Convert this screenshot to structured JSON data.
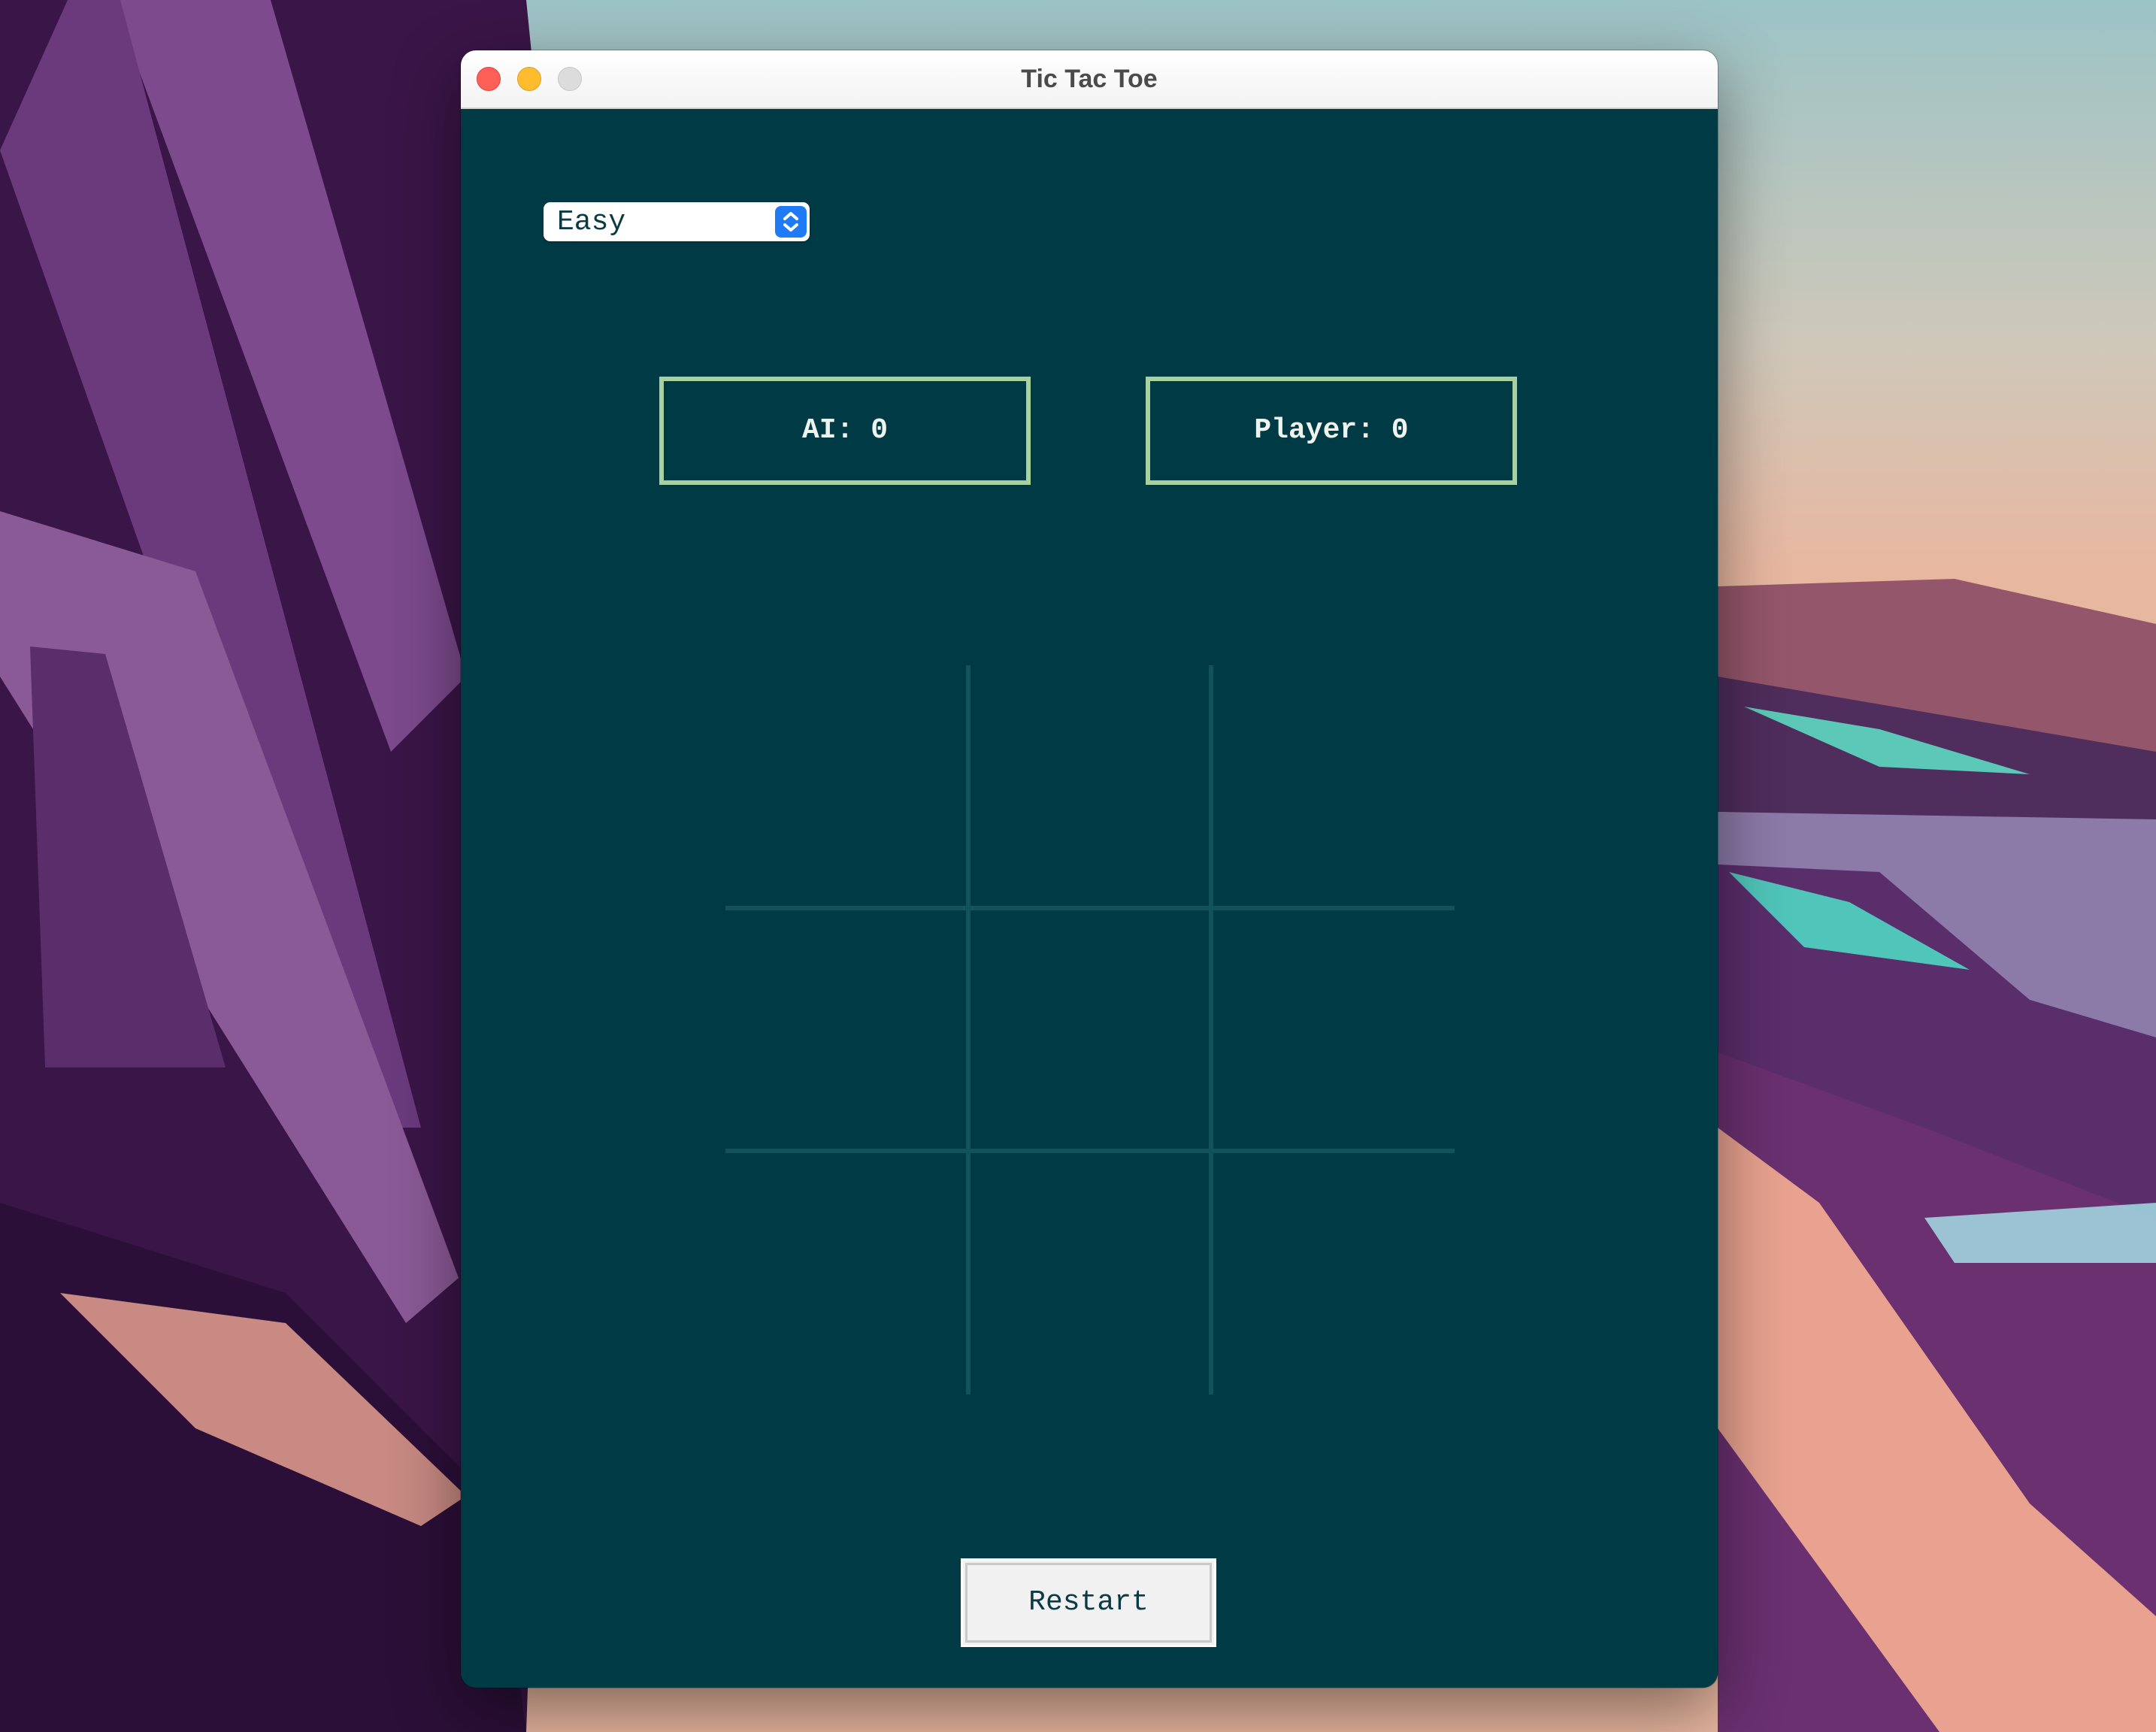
{
  "window": {
    "title": "Tic Tac Toe"
  },
  "difficulty": {
    "selected": "Easy",
    "options": [
      "Easy"
    ]
  },
  "scores": {
    "ai_label": "AI: 0",
    "player_label": "Player: 0"
  },
  "board": {
    "cells": [
      "",
      "",
      "",
      "",
      "",
      "",
      "",
      "",
      ""
    ]
  },
  "controls": {
    "restart_label": "Restart"
  },
  "colors": {
    "background": "#003b45",
    "score_border": "#a9d1a0",
    "grid_line": "#12525b",
    "select_accent": "#1f7bf5",
    "close": "#fe5f57",
    "minimize": "#febc2e",
    "zoom_disabled": "#dcdcdc"
  }
}
